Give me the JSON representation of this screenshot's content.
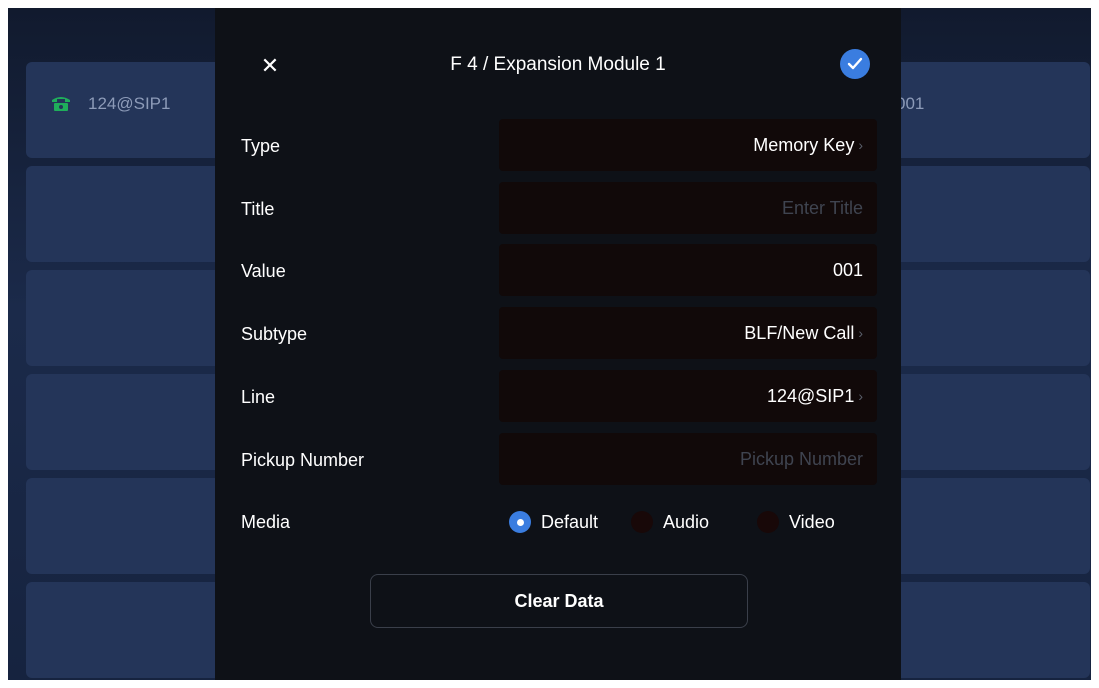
{
  "background": {
    "left_keys": [
      {
        "label": "124@SIP1",
        "icon": "phone-icon"
      },
      {
        "label": ""
      },
      {
        "label": ""
      },
      {
        "label": ""
      },
      {
        "label": ""
      },
      {
        "label": ""
      }
    ],
    "right_keys": [
      {
        "label": "001"
      },
      {
        "label": ""
      },
      {
        "label": ""
      },
      {
        "label": ""
      },
      {
        "label": ""
      },
      {
        "label": ""
      }
    ]
  },
  "dialog": {
    "title": "F 4 / Expansion Module 1",
    "close_icon": "close-icon",
    "confirm_icon": "check-icon",
    "fields": {
      "type": {
        "label": "Type",
        "value": "Memory Key"
      },
      "title": {
        "label": "Title",
        "value": "",
        "placeholder": "Enter Title"
      },
      "value": {
        "label": "Value",
        "value": "001"
      },
      "subtype": {
        "label": "Subtype",
        "value": "BLF/New Call"
      },
      "line": {
        "label": "Line",
        "value": "124@SIP1"
      },
      "pickup": {
        "label": "Pickup Number",
        "value": "",
        "placeholder": "Pickup Number"
      }
    },
    "media": {
      "label": "Media",
      "options": [
        "Default",
        "Audio",
        "Video"
      ],
      "selected": "Default"
    },
    "clear_button": "Clear Data"
  },
  "colors": {
    "accent": "#3a7de0",
    "dialog_bg": "#0e1117",
    "field_bg": "#110909"
  }
}
